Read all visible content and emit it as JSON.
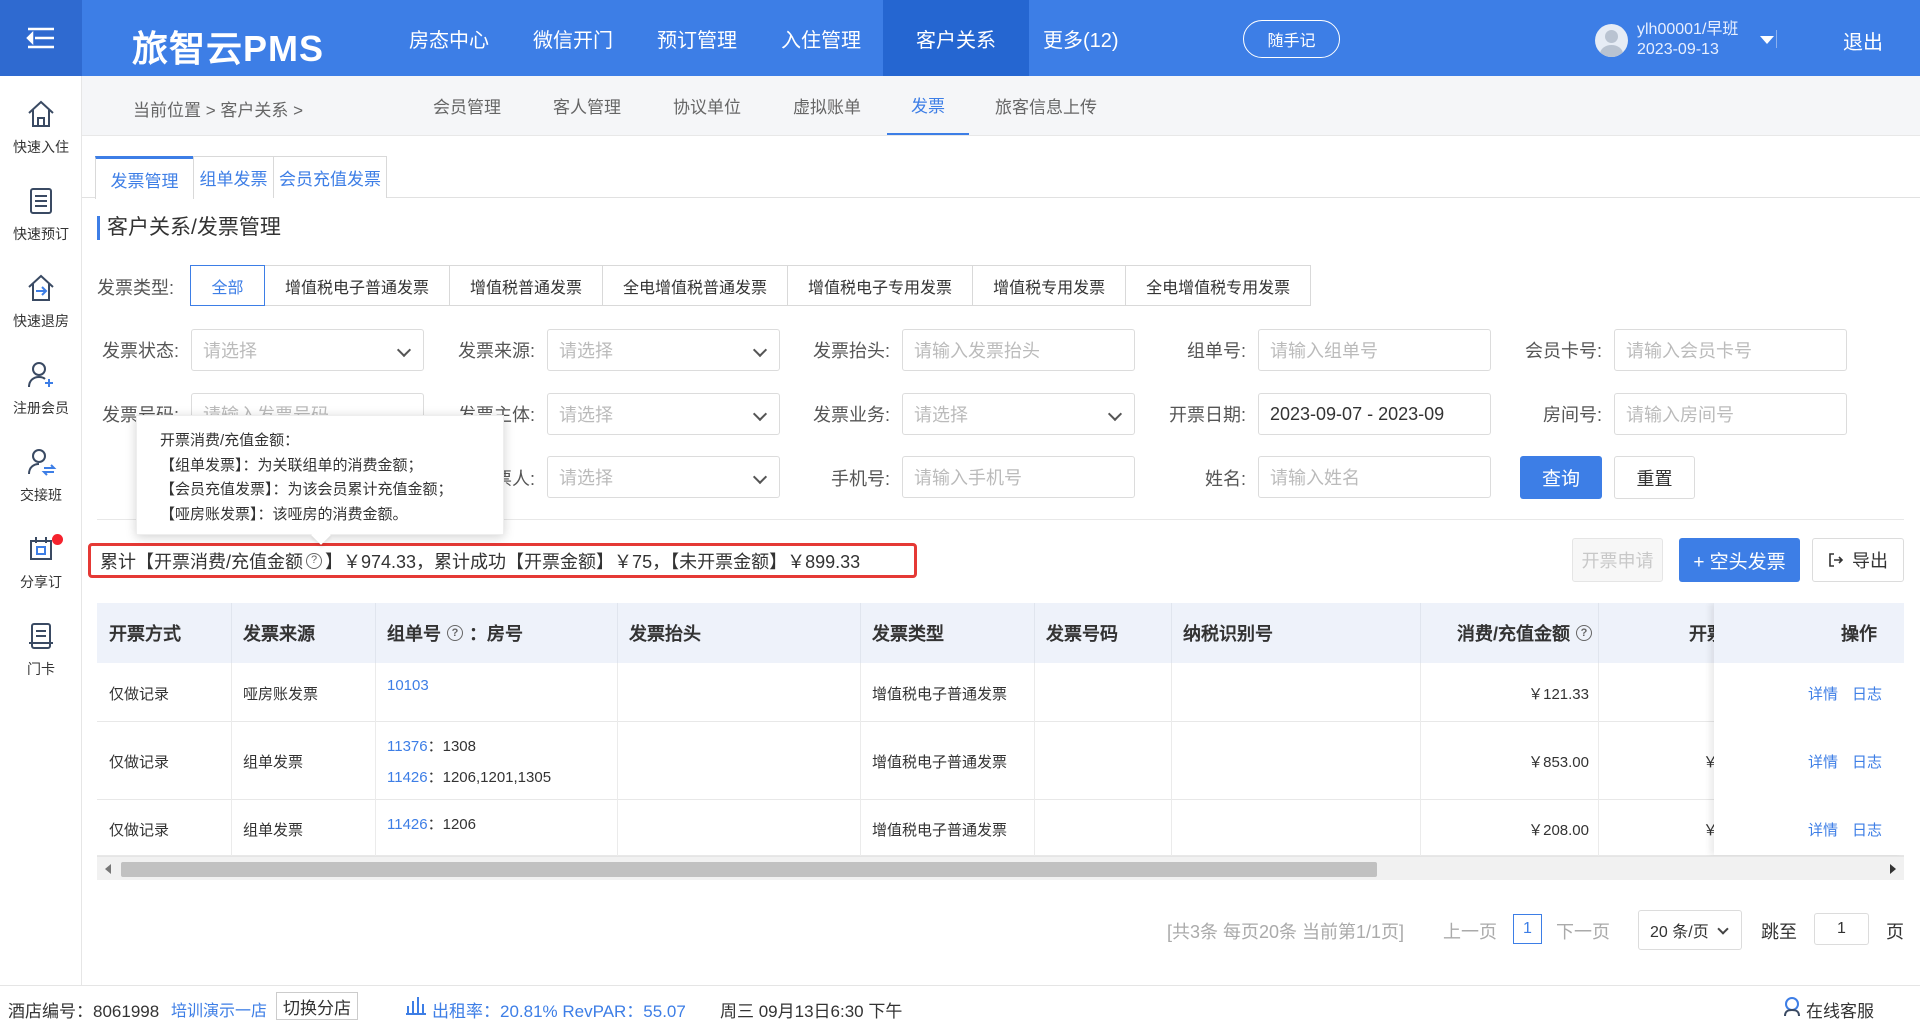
{
  "brand": "旅智云PMS",
  "topnav": [
    "房态中心",
    "微信开门",
    "预订管理",
    "入住管理",
    "客户关系",
    "更多(12)"
  ],
  "topnav_active": "客户关系",
  "memo_btn": "随手记",
  "user": {
    "name": "ylh00001/早班",
    "date": "2023-09-13"
  },
  "logout": "退出",
  "sidebar": [
    "快速入住",
    "快速预订",
    "快速退房",
    "注册会员",
    "交接班",
    "分享订",
    "门卡"
  ],
  "breadcrumb": "当前位置 > 客户关系 >",
  "subnav": [
    "会员管理",
    "客人管理",
    "协议单位",
    "虚拟账单",
    "发票",
    "旅客信息上传"
  ],
  "tabs": [
    "发票管理",
    "组单发票",
    "会员充值发票"
  ],
  "section_title": "客户关系/发票管理",
  "invoice_type": {
    "label": "发票类型:",
    "options": [
      "全部",
      "增值税电子普通发票",
      "增值税普通发票",
      "全电增值税普通发票",
      "增值税电子专用发票",
      "增值税专用发票",
      "全电增值税专用发票"
    ]
  },
  "filters": {
    "status": {
      "label": "发票状态:",
      "placeholder": "请选择"
    },
    "source": {
      "label": "发票来源:",
      "placeholder": "请选择"
    },
    "header": {
      "label": "发票抬头:",
      "placeholder": "请输入发票抬头"
    },
    "order": {
      "label": "组单号:",
      "placeholder": "请输入组单号"
    },
    "member": {
      "label": "会员卡号:",
      "placeholder": "请输入会员卡号"
    },
    "number": {
      "label": "发票号码:",
      "placeholder": "请输入发票号码"
    },
    "subject": {
      "label": "发票主体:",
      "placeholder": "请选择"
    },
    "business": {
      "label": "发票业务:",
      "placeholder": "请选择"
    },
    "date": {
      "label": "开票日期:",
      "value": "2023-09-07 - 2023-09"
    },
    "room": {
      "label": "房间号:",
      "placeholder": "请输入房间号"
    },
    "operator": {
      "label": "开票人:",
      "placeholder": "请选择"
    },
    "phone": {
      "label": "手机号:",
      "placeholder": "请输入手机号"
    },
    "name": {
      "label": "姓名:",
      "placeholder": "请输入姓名"
    }
  },
  "query_btn": "查询",
  "reset_btn": "重置",
  "tooltip": [
    "开票消费/充值金额：",
    "【组单发票】：为关联组单的消费金额；",
    "【会员充值发票】：为该会员累计充值金额；",
    "【哑房账发票】：该哑房的消费金额。"
  ],
  "summary": {
    "prefix": "累计【开票消费/充值金额",
    "mid": "】￥974.33，累计成功【开票金额】￥75，【未开票金额】￥899.33"
  },
  "apply_btn": "开票申请",
  "blank_btn": "+ 空头发票",
  "export_btn": "导出",
  "table": {
    "headers": [
      "开票方式",
      "发票来源",
      "组单号",
      "：房号",
      "发票抬头",
      "发票类型",
      "发票号码",
      "纳税识别号",
      "消费/充值金额",
      "开票",
      "操作"
    ],
    "rows": [
      {
        "method": "仅做记录",
        "source": "哑房账发票",
        "orders": [
          {
            "no": "10103",
            "rooms": ""
          }
        ],
        "type": "增值税电子普通发票",
        "amount": "￥121.33",
        "invoiced": ""
      },
      {
        "method": "仅做记录",
        "source": "组单发票",
        "orders": [
          {
            "no": "11376",
            "rooms": "：1308"
          },
          {
            "no": "11426",
            "rooms": "：1206,1201,1305"
          }
        ],
        "type": "增值税电子普通发票",
        "amount": "￥853.00",
        "invoiced": "￥"
      },
      {
        "method": "仅做记录",
        "source": "组单发票",
        "orders": [
          {
            "no": "11426",
            "rooms": "：1206"
          }
        ],
        "type": "增值税电子普通发票",
        "amount": "￥208.00",
        "invoiced": "￥"
      }
    ],
    "ops": [
      "详情",
      "日志"
    ]
  },
  "pagination": {
    "info": "[共3条 每页20条 当前第1/1页]",
    "prev": "上一页",
    "current": "1",
    "next": "下一页",
    "size": "20 条/页",
    "jump": "跳至",
    "jump_value": "1",
    "page": "页"
  },
  "statusbar": {
    "hotel_label": "酒店编号：8061998",
    "hotel_name": "培训演示一店",
    "switch": "切换分店",
    "occupancy": "出租率：20.81% RevPAR：55.07",
    "datetime": "周三 09月13日6:30 下午",
    "service": "在线客服"
  }
}
